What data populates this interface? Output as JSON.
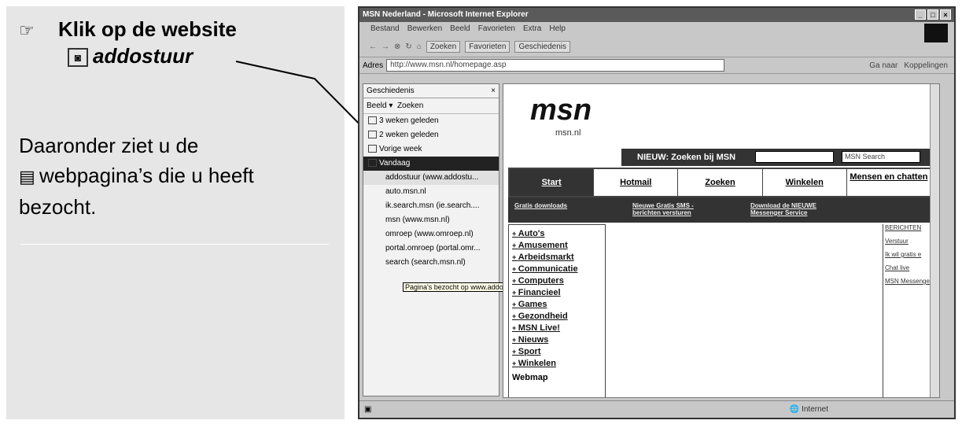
{
  "instructions": {
    "step_text": "Klik op de website",
    "site_name": "addostuur",
    "description_1": "Daaronder ziet u de",
    "description_2": "webpagina’s die u heeft",
    "description_3": "bezocht."
  },
  "browser": {
    "title": "MSN Nederland - Microsoft Internet Explorer",
    "menu": [
      "Bestand",
      "Bewerken",
      "Beeld",
      "Favorieten",
      "Extra",
      "Help"
    ],
    "toolbar": [
      "Zoeken",
      "Favorieten",
      "Geschiedenis"
    ],
    "address_label": "Adres",
    "address_value": "http://www.msn.nl/homepage.asp",
    "go_label": "Ga naar",
    "links_label": "Koppelingen",
    "history": {
      "title": "Geschiedenis",
      "view_label": "Beeld",
      "search_label": "Zoeken",
      "periods": [
        "3 weken geleden",
        "2 weken geleden",
        "Vorige week",
        "Vandaag"
      ],
      "sites": [
        "addostuur (www.addostu...",
        "auto.msn.nl",
        "ik.search.msn (ie.search....",
        "msn (www.msn.nl)",
        "omroep (www.omroep.nl)",
        "portal.omroep (portal.omr...",
        "search (search.msn.nl)"
      ],
      "tooltip": "Pagina's bezocht op www.addostuur.com"
    },
    "page": {
      "logo": "msn",
      "logo_sub": "msn.nl",
      "promo": "NIEUW: Zoeken bij MSN",
      "search_select": "MSN Search",
      "nav": [
        "Start",
        "Hotmail",
        "Zoeken",
        "Winkelen",
        "Mensen en chatten"
      ],
      "banners": [
        "Gratis downloads",
        "Nieuwe Gratis SMS - berichten versturen",
        "Download de NIEUWE Messenger Service"
      ],
      "categories": [
        "Auto's",
        "Amusement",
        "Arbeidsmarkt",
        "Communicatie",
        "Computers",
        "Financieel",
        "Games",
        "Gezondheid",
        "MSN Live!",
        "Nieuws",
        "Sport",
        "Winkelen"
      ],
      "webmap": "Webmap",
      "right_col": [
        "BERICHTEN",
        "Verstuur",
        "Ik wil gratis e",
        "Chat live",
        "MSN Messenger"
      ]
    },
    "status_zone": "Internet"
  }
}
